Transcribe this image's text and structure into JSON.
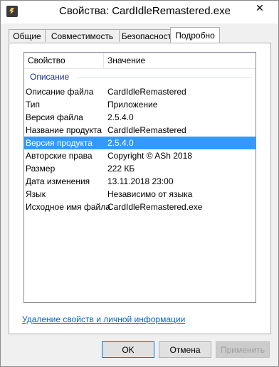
{
  "window": {
    "title": "Свойства: CardIdleRemastered.exe",
    "icon": "lightning-app-icon",
    "close_glyph": "✕"
  },
  "tabs": [
    {
      "label": "Общие"
    },
    {
      "label": "Совместимость"
    },
    {
      "label": "Безопасность"
    },
    {
      "label": "Подробно",
      "active": true
    }
  ],
  "list": {
    "columns": [
      "Свойство",
      "Значение"
    ],
    "group_label": "Описание",
    "rows": [
      {
        "name": "Описание файла",
        "value": "CardIdleRemastered"
      },
      {
        "name": "Тип",
        "value": "Приложение"
      },
      {
        "name": "Версия файла",
        "value": "2.5.4.0"
      },
      {
        "name": "Название продукта",
        "value": "CardIdleRemastered"
      },
      {
        "name": "Версия продукта",
        "value": "2.5.4.0",
        "selected": true
      },
      {
        "name": "Авторские права",
        "value": "Copyright © ASh 2018"
      },
      {
        "name": "Размер",
        "value": "222 КБ"
      },
      {
        "name": "Дата изменения",
        "value": "13.11.2018 23:00"
      },
      {
        "name": "Язык",
        "value": "Независимо от языка"
      },
      {
        "name": "Исходное имя файла",
        "value": "CardIdleRemastered.exe"
      }
    ]
  },
  "privacy_link": "Удаление свойств и личной информации",
  "buttons": {
    "ok": "OK",
    "cancel": "Отмена",
    "apply": "Применить"
  },
  "colors": {
    "selection": "#3399ff",
    "group_text": "#1e3287",
    "link": "#0066cc"
  }
}
